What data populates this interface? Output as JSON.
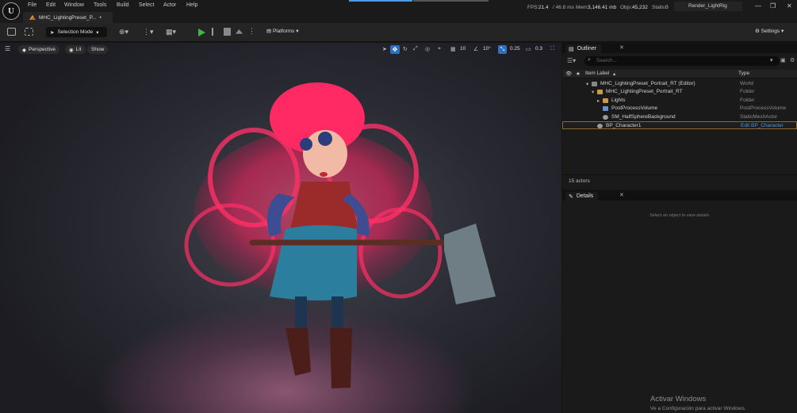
{
  "menu": [
    "File",
    "Edit",
    "Window",
    "Tools",
    "Build",
    "Select",
    "Actor",
    "Help"
  ],
  "tab": {
    "label": "MHC_LightingPreset_P...",
    "modified": "•"
  },
  "stats": {
    "fps_label": "FPS:",
    "fps": "21.4",
    "ms": "/ 46.8 ms",
    "mem_label": "Mem:",
    "mem": "3,146.41 mb",
    "objs_label": "Objs:",
    "objs": "45,232",
    "stalls_label": "Stalls:",
    "stalls": "0"
  },
  "render_preset": "Render_LightRig",
  "toolbar": {
    "mode": "Selection Mode",
    "platforms": "Platforms",
    "settings": "Settings"
  },
  "viewport": {
    "perspective": "Perspective",
    "lit": "Lit",
    "show": "Show",
    "grid_size": "10",
    "rotation": "10°",
    "scale": "0.25",
    "camera_speed": "0.3"
  },
  "outliner": {
    "title": "Outliner",
    "search_placeholder": "Search...",
    "col_label": "Item Label",
    "col_type": "Type",
    "rows": [
      {
        "name": "MHC_LightingPreset_Portrait_RT (Editor)",
        "type": "World"
      },
      {
        "name": "MHC_LightingPreset_Portrait_RT",
        "type": "Folder"
      },
      {
        "name": "Lights",
        "type": "Folder"
      },
      {
        "name": "PostProcessVolume",
        "type": "PostProcessVolume"
      },
      {
        "name": "SM_HalfSphereBackground",
        "type": "StaticMeshActor"
      },
      {
        "name": "BP_Character1",
        "type": "Edit BP_Character"
      }
    ],
    "count": "15 actors"
  },
  "details": {
    "title": "Details",
    "hint": "Select an object to view details."
  },
  "watermark": {
    "line1": "Activar Windows",
    "line2": "Ve a Configuración para activar Windows."
  },
  "colors": {
    "accent": "#4c9be8",
    "play": "#45b34a",
    "hair": "#ff1f5e",
    "selection": "#8a6a2c"
  }
}
